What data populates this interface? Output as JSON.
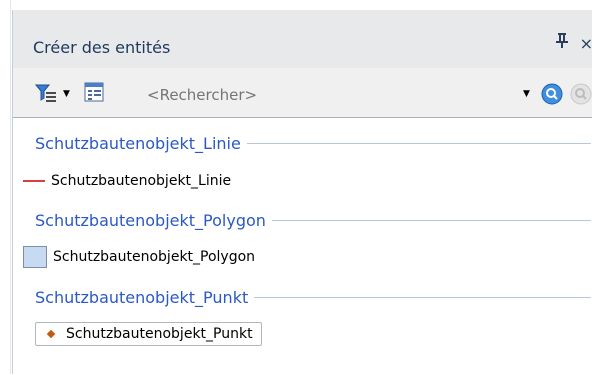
{
  "panel": {
    "title": "Créer des entités",
    "pin_glyph": "ꟼ",
    "close_glyph": "×"
  },
  "toolbar": {
    "filter_icon": "filter-icon",
    "layout_icon": "table-icon",
    "search_placeholder": "<Rechercher>",
    "search_icon": "search-icon",
    "advanced_search_icon": "advanced-search-icon"
  },
  "groups": [
    {
      "header": "Schutzbautenobjekt_Linie",
      "template": "Schutzbautenobjekt_Linie",
      "symbol": "line"
    },
    {
      "header": "Schutzbautenobjekt_Polygon",
      "template": "Schutzbautenobjekt_Polygon",
      "symbol": "polygon"
    },
    {
      "header": "Schutzbautenobjekt_Punkt",
      "template": "Schutzbautenobjekt_Punkt",
      "symbol": "point"
    }
  ],
  "colors": {
    "group_header": "#2b59c3",
    "line_symbol": "#d64040",
    "polygon_fill": "#c6daf2",
    "point_symbol": "#c25a12"
  }
}
